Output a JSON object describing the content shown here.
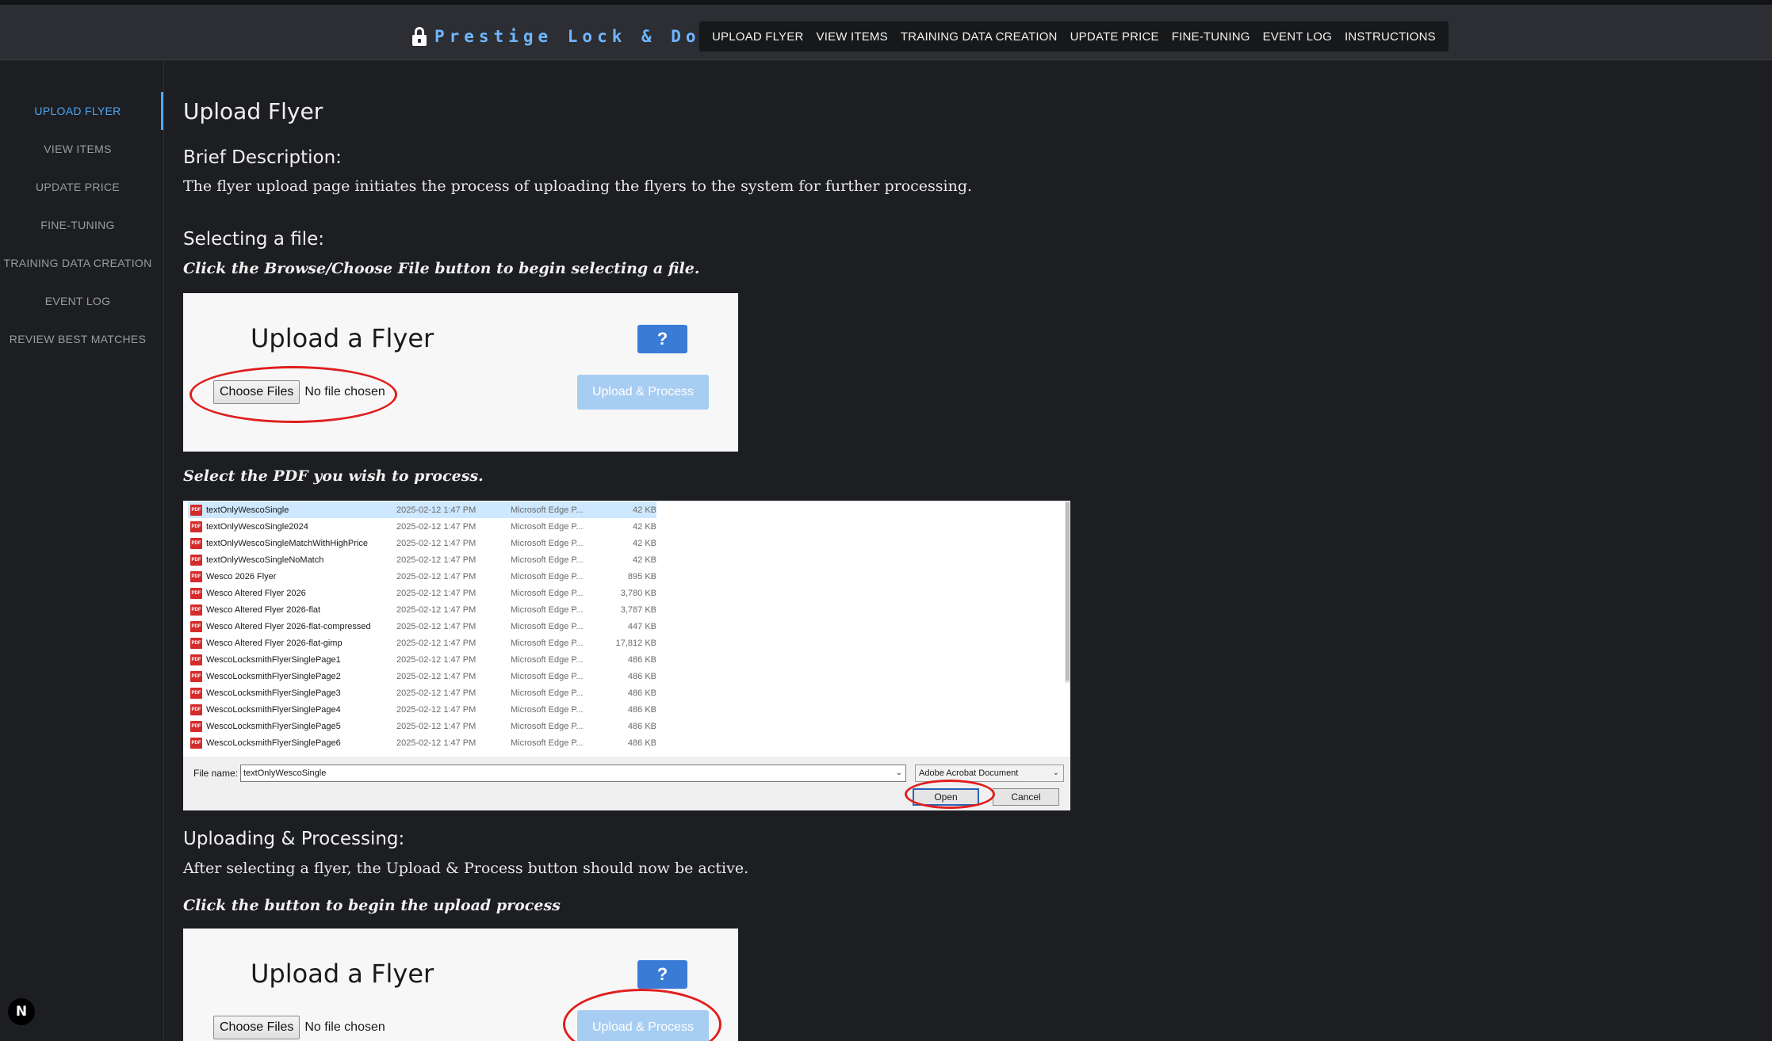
{
  "app": {
    "brand": "Prestige Lock & Door",
    "nav": [
      "UPLOAD FLYER",
      "VIEW ITEMS",
      "TRAINING DATA CREATION",
      "UPDATE PRICE",
      "FINE-TUNING",
      "EVENT LOG",
      "INSTRUCTIONS"
    ]
  },
  "sidebar": {
    "items": [
      {
        "label": "UPLOAD FLYER",
        "active": true
      },
      {
        "label": "VIEW ITEMS",
        "active": false
      },
      {
        "label": "UPDATE PRICE",
        "active": false
      },
      {
        "label": "FINE-TUNING",
        "active": false
      },
      {
        "label": "TRAINING DATA CREATION",
        "active": false
      },
      {
        "label": "EVENT LOG",
        "active": false
      },
      {
        "label": "REVIEW BEST MATCHES",
        "active": false
      }
    ]
  },
  "badge": "N",
  "content": {
    "title": "Upload Flyer",
    "brief_heading": "Brief Description:",
    "brief_text": "The flyer upload page initiates the process of uploading the flyers to the system for further processing.",
    "select_heading": "Selecting a file:",
    "select_instruction": "Click the Browse/Choose File button to begin selecting a file.",
    "select_pdf_instruction": "Select the PDF you wish to process.",
    "upload_heading": "Uploading & Processing:",
    "upload_text": "After selecting a flyer, the Upload & Process button should now be active.",
    "upload_instruction": "Click the button to begin the upload process"
  },
  "card": {
    "title": "Upload a Flyer",
    "help": "?",
    "choose_label": "Choose Files",
    "status": "No file chosen",
    "upload_label": "Upload & Process"
  },
  "dialog": {
    "files": [
      {
        "name": "textOnlyWescoSingle",
        "date": "2025-02-12 1:47 PM",
        "type": "Microsoft Edge P...",
        "size": "42 KB",
        "selected": true
      },
      {
        "name": "textOnlyWescoSingle2024",
        "date": "2025-02-12 1:47 PM",
        "type": "Microsoft Edge P...",
        "size": "42 KB"
      },
      {
        "name": "textOnlyWescoSingleMatchWithHighPrice",
        "date": "2025-02-12 1:47 PM",
        "type": "Microsoft Edge P...",
        "size": "42 KB"
      },
      {
        "name": "textOnlyWescoSingleNoMatch",
        "date": "2025-02-12 1:47 PM",
        "type": "Microsoft Edge P...",
        "size": "42 KB"
      },
      {
        "name": "Wesco 2026 Flyer",
        "date": "2025-02-12 1:47 PM",
        "type": "Microsoft Edge P...",
        "size": "895 KB"
      },
      {
        "name": "Wesco Altered Flyer 2026",
        "date": "2025-02-12 1:47 PM",
        "type": "Microsoft Edge P...",
        "size": "3,780 KB"
      },
      {
        "name": "Wesco Altered Flyer 2026-flat",
        "date": "2025-02-12 1:47 PM",
        "type": "Microsoft Edge P...",
        "size": "3,787 KB"
      },
      {
        "name": "Wesco Altered Flyer 2026-flat-compressed",
        "date": "2025-02-12 1:47 PM",
        "type": "Microsoft Edge P...",
        "size": "447 KB"
      },
      {
        "name": "Wesco Altered Flyer 2026-flat-gimp",
        "date": "2025-02-12 1:47 PM",
        "type": "Microsoft Edge P...",
        "size": "17,812 KB"
      },
      {
        "name": "WescoLocksmithFlyerSinglePage1",
        "date": "2025-02-12 1:47 PM",
        "type": "Microsoft Edge P...",
        "size": "486 KB"
      },
      {
        "name": "WescoLocksmithFlyerSinglePage2",
        "date": "2025-02-12 1:47 PM",
        "type": "Microsoft Edge P...",
        "size": "486 KB"
      },
      {
        "name": "WescoLocksmithFlyerSinglePage3",
        "date": "2025-02-12 1:47 PM",
        "type": "Microsoft Edge P...",
        "size": "486 KB"
      },
      {
        "name": "WescoLocksmithFlyerSinglePage4",
        "date": "2025-02-12 1:47 PM",
        "type": "Microsoft Edge P...",
        "size": "486 KB"
      },
      {
        "name": "WescoLocksmithFlyerSinglePage5",
        "date": "2025-02-12 1:47 PM",
        "type": "Microsoft Edge P...",
        "size": "486 KB"
      },
      {
        "name": "WescoLocksmithFlyerSinglePage6",
        "date": "2025-02-12 1:47 PM",
        "type": "Microsoft Edge P...",
        "size": "486 KB"
      }
    ],
    "pdf_icon_text": "PDF",
    "file_name_label": "File name:",
    "file_name_value": "textOnlyWescoSingle",
    "file_type": "Adobe Acrobat Document",
    "open_label": "Open",
    "cancel_label": "Cancel"
  },
  "colors": {
    "accent": "#4ea7f5",
    "brand": "#6fb6ff",
    "highlight_ring": "#e01e1e",
    "help_button": "#3a7bd5",
    "upload_button_disabled": "#a8cdf2"
  }
}
